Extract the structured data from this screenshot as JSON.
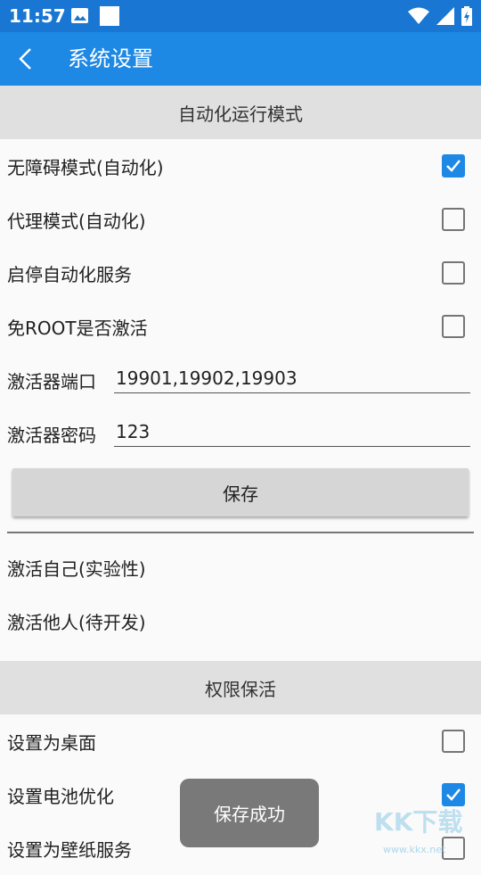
{
  "status_bar": {
    "time": "11:57",
    "icons": [
      "image-icon",
      "white-square",
      "wifi-icon",
      "signal-icon",
      "battery-charging-icon"
    ]
  },
  "app_bar": {
    "title": "系统设置",
    "back_icon": "chevron-left-icon",
    "background": "#1e88e5"
  },
  "sections": {
    "automation": {
      "header": "自动化运行模式",
      "options": [
        {
          "label": "无障碍模式(自动化)",
          "checked": true
        },
        {
          "label": "代理模式(自动化)",
          "checked": false
        },
        {
          "label": "启停自动化服务",
          "checked": false
        },
        {
          "label": "免ROOT是否激活",
          "checked": false
        }
      ],
      "fields": [
        {
          "label": "激活器端口",
          "value": "19901,19902,19903"
        },
        {
          "label": "激活器密码",
          "value": "123"
        }
      ],
      "save_label": "保存",
      "actions": [
        "激活自己(实验性)",
        "激活他人(待开发)"
      ]
    },
    "keepalive": {
      "header": "权限保活",
      "options": [
        {
          "label": "设置为桌面",
          "checked": false
        },
        {
          "label": "设置电池优化",
          "checked": true
        },
        {
          "label": "设置为壁纸服务",
          "checked": false
        }
      ]
    }
  },
  "toast": "保存成功",
  "watermark": {
    "text": "KK下载",
    "sub": "www.kkx.net"
  },
  "colors": {
    "accent": "#1e88e5",
    "status_bar": "#1976d2",
    "header_bg": "#e0e0e0"
  }
}
